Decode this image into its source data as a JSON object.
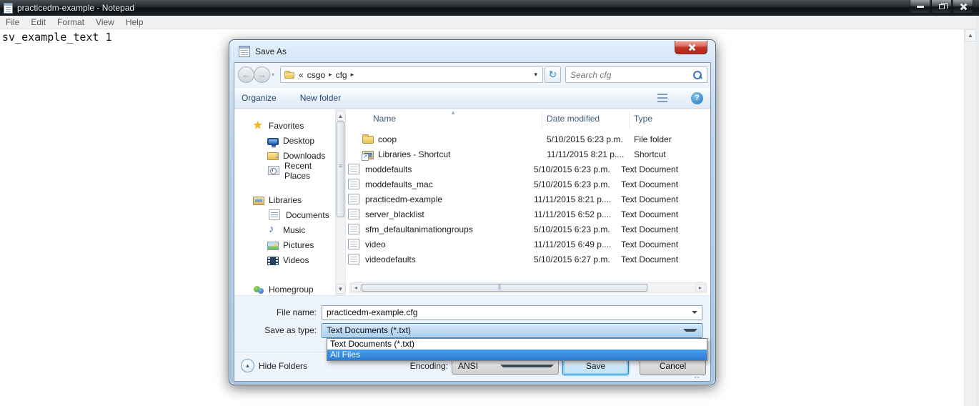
{
  "notepad": {
    "title": "practicedm-example - Notepad",
    "menu": [
      {
        "label": "File"
      },
      {
        "label": "Edit"
      },
      {
        "label": "Format"
      },
      {
        "label": "View"
      },
      {
        "label": "Help"
      }
    ],
    "document_text": "sv_example_text 1"
  },
  "dialog": {
    "title": "Save As",
    "nav": {
      "breadcrumb_prefix": "«",
      "crumbs": [
        {
          "label": "csgo"
        },
        {
          "label": "cfg"
        }
      ],
      "search_placeholder": "Search cfg"
    },
    "toolbar": {
      "organize_label": "Organize",
      "new_folder_label": "New folder"
    },
    "sidebar": {
      "items": [
        {
          "label": "Favorites",
          "icon": "star",
          "cls": "group"
        },
        {
          "label": "Desktop",
          "icon": "desktop",
          "cls": "child"
        },
        {
          "label": "Downloads",
          "icon": "downloads",
          "cls": "child"
        },
        {
          "label": "Recent Places",
          "icon": "recent",
          "cls": "child"
        },
        {
          "label": "Libraries",
          "icon": "libraries",
          "cls": "group gap"
        },
        {
          "label": "Documents",
          "icon": "documents",
          "cls": "child"
        },
        {
          "label": "Music",
          "icon": "music",
          "cls": "child"
        },
        {
          "label": "Pictures",
          "icon": "pictures",
          "cls": "child"
        },
        {
          "label": "Videos",
          "icon": "videos",
          "cls": "child"
        },
        {
          "label": "Homegroup",
          "icon": "homegroup",
          "cls": "group gap"
        }
      ]
    },
    "file_list": {
      "columns": {
        "name": "Name",
        "date": "Date modified",
        "type": "Type"
      },
      "rows": [
        {
          "name": "coop",
          "icon": "folder",
          "date": "5/10/2015 6:23 p.m.",
          "type": "File folder"
        },
        {
          "name": "Libraries - Shortcut",
          "icon": "shortcut",
          "date": "11/11/2015 8:21 p....",
          "type": "Shortcut"
        },
        {
          "name": "moddefaults",
          "icon": "text",
          "date": "5/10/2015 6:23 p.m.",
          "type": "Text Document"
        },
        {
          "name": "moddefaults_mac",
          "icon": "text",
          "date": "5/10/2015 6:23 p.m.",
          "type": "Text Document"
        },
        {
          "name": "practicedm-example",
          "icon": "text",
          "date": "11/11/2015 8:21 p....",
          "type": "Text Document"
        },
        {
          "name": "server_blacklist",
          "icon": "text",
          "date": "11/11/2015 6:52 p....",
          "type": "Text Document"
        },
        {
          "name": "sfm_defaultanimationgroups",
          "icon": "text",
          "date": "5/10/2015 6:23 p.m.",
          "type": "Text Document"
        },
        {
          "name": "video",
          "icon": "text",
          "date": "11/11/2015 6:49 p....",
          "type": "Text Document"
        },
        {
          "name": "videodefaults",
          "icon": "text",
          "date": "5/10/2015 6:27 p.m.",
          "type": "Text Document"
        }
      ]
    },
    "file_name": {
      "label": "File name:",
      "value": "practicedm-example.cfg"
    },
    "save_as_type": {
      "label": "Save as type:",
      "value": "Text Documents (*.txt)"
    },
    "type_dropdown": {
      "options": [
        {
          "label": "Text Documents (*.txt)",
          "cls": ""
        },
        {
          "label": "All Files",
          "cls": "sel"
        }
      ]
    },
    "footer": {
      "hide_folders_label": "Hide Folders",
      "encoding_label": "Encoding:",
      "encoding_value": "ANSI",
      "save_label": "Save",
      "cancel_label": "Cancel"
    }
  },
  "colors": {
    "selection_blue": "#2b7cd0",
    "close_button_red": "#c3372a",
    "dialog_glass": "#b8d3ec",
    "default_button_glow": "#8ed0f3"
  }
}
